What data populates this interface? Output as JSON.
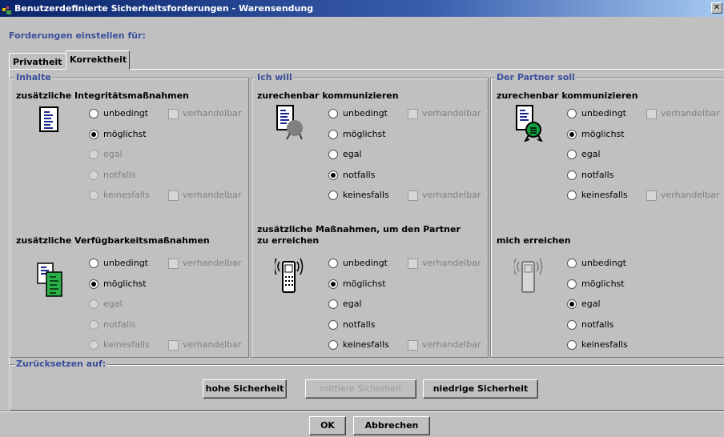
{
  "window": {
    "title": "Benutzerdefinierte Sicherheitsforderungen - Warensendung",
    "close": "✕"
  },
  "forderungen_label": "Forderungen einstellen für:",
  "tabs": [
    {
      "label": "Privatheit"
    },
    {
      "label": "Korrektheit"
    }
  ],
  "groups": {
    "inhalte": {
      "legend": "Inhalte"
    },
    "ichwill": {
      "legend": "Ich will"
    },
    "partner": {
      "legend": "Der Partner soll"
    }
  },
  "sections": {
    "integritaet": {
      "header": "zusätzliche Integritätsmaßnahmen",
      "selected": "möglichst"
    },
    "verfuegbarkeit": {
      "header": "zusätzliche Verfügbarkeitsmaßnahmen",
      "selected": "möglichst"
    },
    "ich_zurechenbar": {
      "header": "zurechenbar kommunizieren",
      "selected": "notfalls"
    },
    "ich_erreichen": {
      "header1": "zusätzliche Maßnahmen, um den Partner",
      "header2": "zu erreichen",
      "selected": "möglichst"
    },
    "partner_zurechenbar": {
      "header": "zurechenbar kommunizieren",
      "selected": "möglichst"
    },
    "partner_erreichen": {
      "header": "mich erreichen",
      "selected": "egal"
    }
  },
  "options": [
    "unbedingt",
    "möglichst",
    "egal",
    "notfalls",
    "keinesfalls"
  ],
  "checkbox_label": "verhandelbar",
  "reset": {
    "legend": "Zurücksetzen auf:",
    "buttons": [
      "hohe Sicherheit",
      "mittlere Sicherheit",
      "niedrige Sicherheit"
    ]
  },
  "footer": {
    "ok": "OK",
    "cancel": "Abbrechen"
  },
  "colors": {
    "legend": "#3b4f9c",
    "titlebar": "#0a246a"
  },
  "icons": [
    "document-icon",
    "document-sealed-icon",
    "document-stamp-icon",
    "document-copies-icon",
    "mobile-phone-icon"
  ]
}
